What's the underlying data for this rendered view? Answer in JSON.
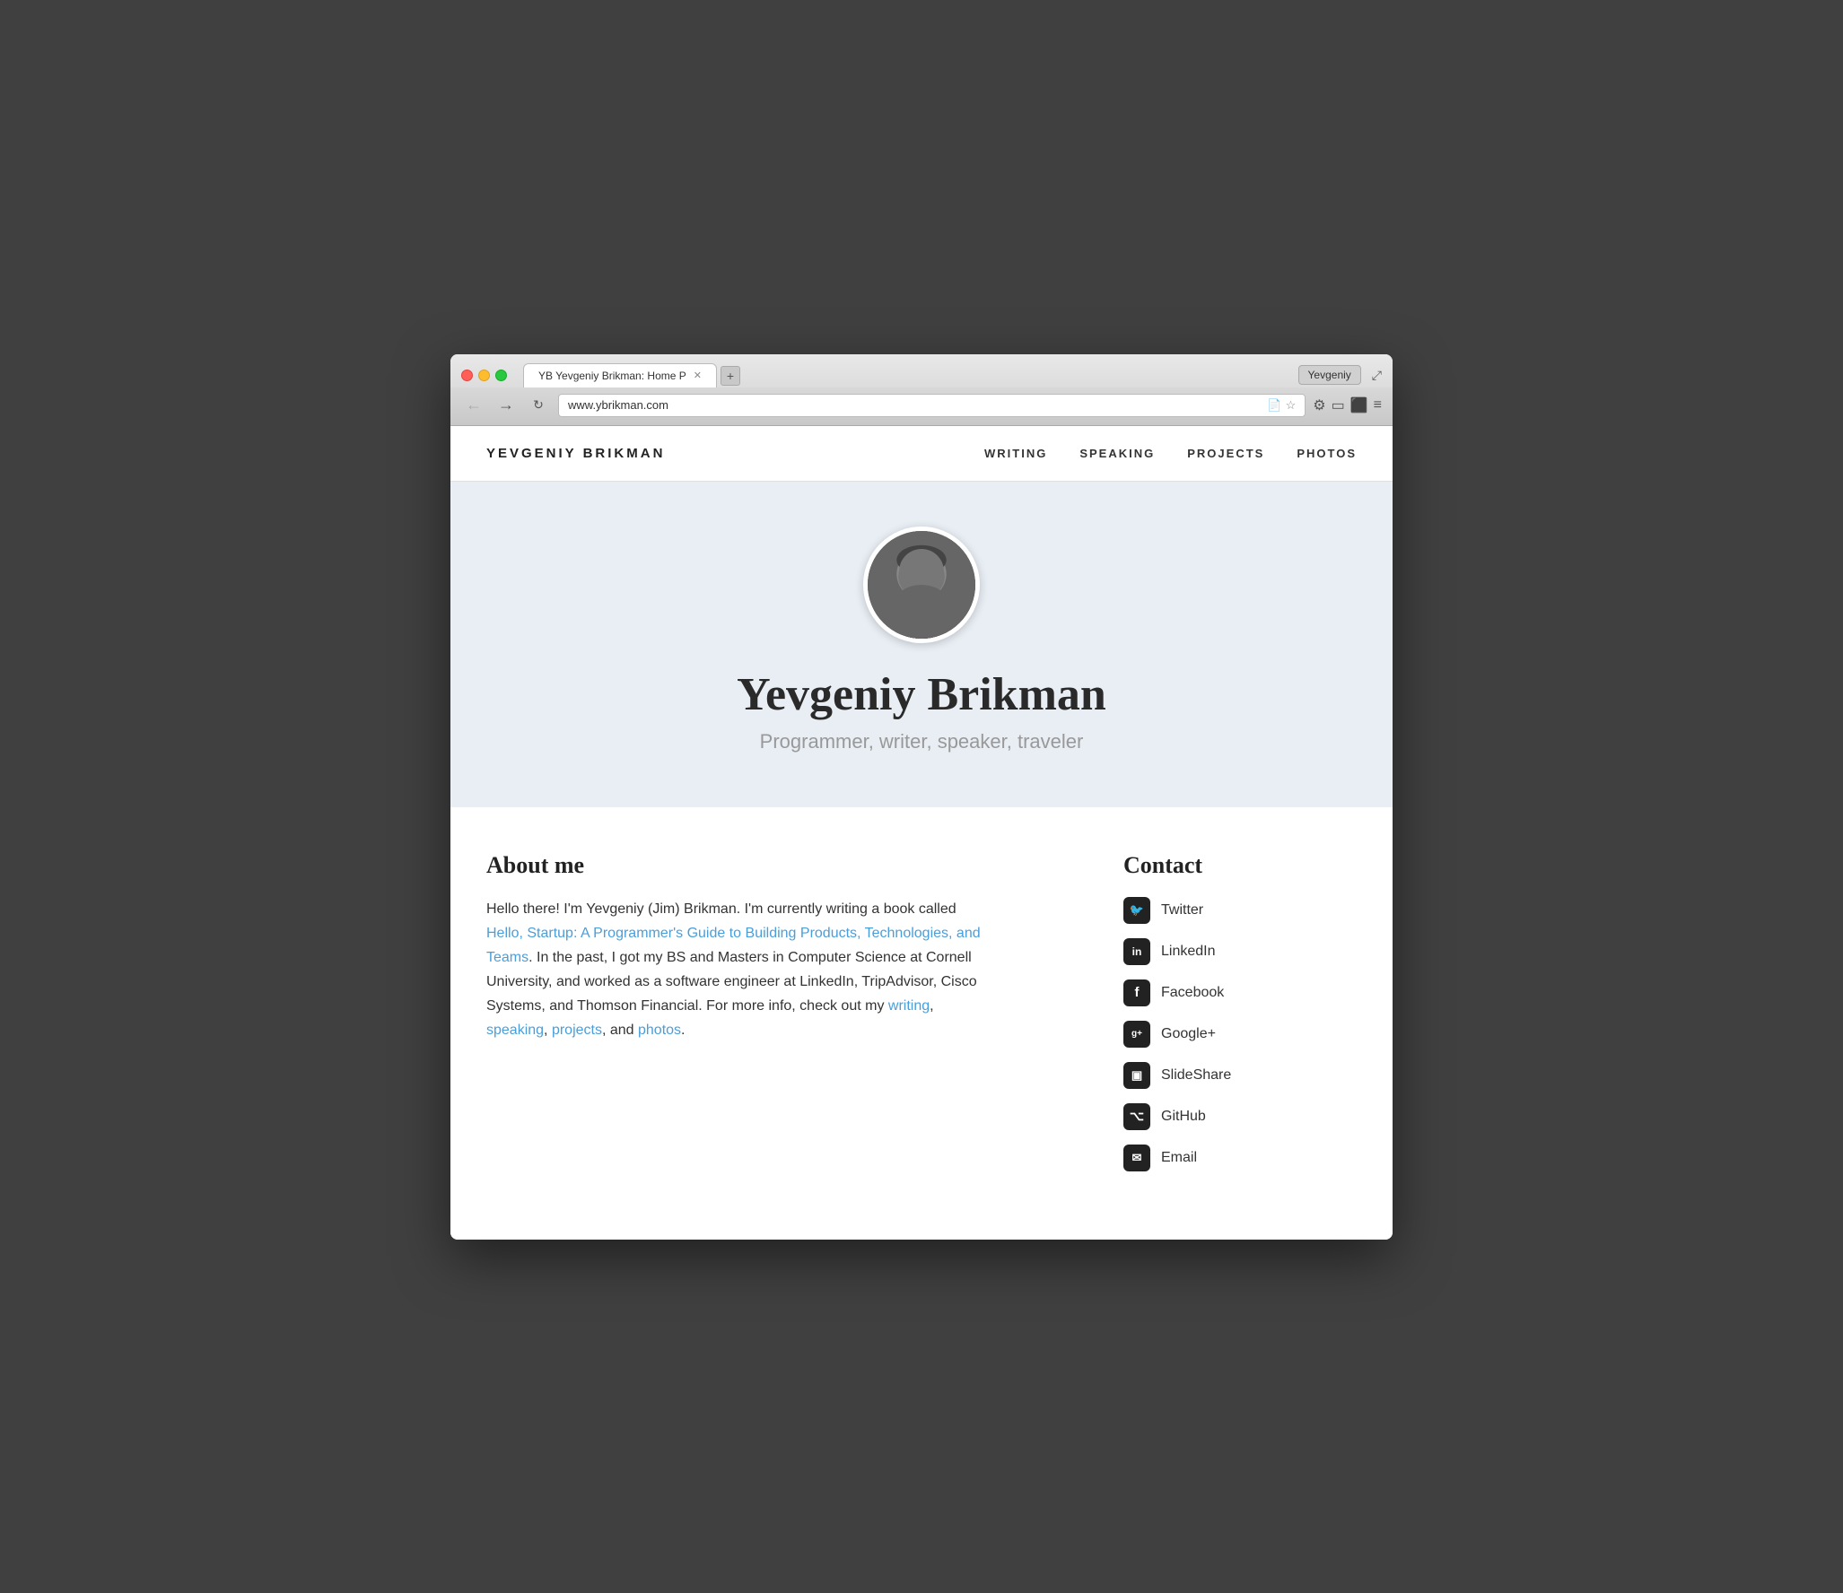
{
  "browser": {
    "tab_title": "YB Yevgeniy Brikman: Home P",
    "url": "www.ybrikman.com",
    "user_label": "Yevgeniy"
  },
  "nav": {
    "logo": "YEVGENIY BRIKMAN",
    "links": [
      {
        "label": "WRITING",
        "href": "#"
      },
      {
        "label": "SPEAKING",
        "href": "#"
      },
      {
        "label": "PROJECTS",
        "href": "#"
      },
      {
        "label": "PHOTOS",
        "href": "#"
      }
    ]
  },
  "hero": {
    "name": "Yevgeniy Brikman",
    "subtitle": "Programmer, writer, speaker, traveler"
  },
  "about": {
    "title": "About me",
    "paragraph1": "Hello there! I'm Yevgeniy (Jim) Brikman. I'm currently writing a book called ",
    "book_link_text": "Hello, Startup: A Programmer's Guide to Building Products, Technologies, and Teams",
    "paragraph2": ". In the past, I got my BS and Masters in Computer Science at Cornell University, and worked as a software engineer at LinkedIn, TripAdvisor, Cisco Systems, and Thomson Financial. For more info, check out my ",
    "writing_link": "writing",
    "speaking_link": "speaking",
    "projects_link": "projects",
    "photos_link": "photos"
  },
  "contact": {
    "title": "Contact",
    "items": [
      {
        "icon": "twitter-icon",
        "icon_class": "icon-twitter",
        "label": "Twitter"
      },
      {
        "icon": "linkedin-icon",
        "icon_class": "icon-linkedin",
        "label": "LinkedIn"
      },
      {
        "icon": "facebook-icon",
        "icon_class": "icon-facebook",
        "label": "Facebook"
      },
      {
        "icon": "googleplus-icon",
        "icon_class": "icon-gplus",
        "label": "Google+"
      },
      {
        "icon": "slideshare-icon",
        "icon_class": "icon-slideshare",
        "label": "SlideShare"
      },
      {
        "icon": "github-icon",
        "icon_class": "icon-github",
        "label": "GitHub"
      },
      {
        "icon": "email-icon",
        "icon_class": "icon-email",
        "label": "Email"
      }
    ]
  }
}
